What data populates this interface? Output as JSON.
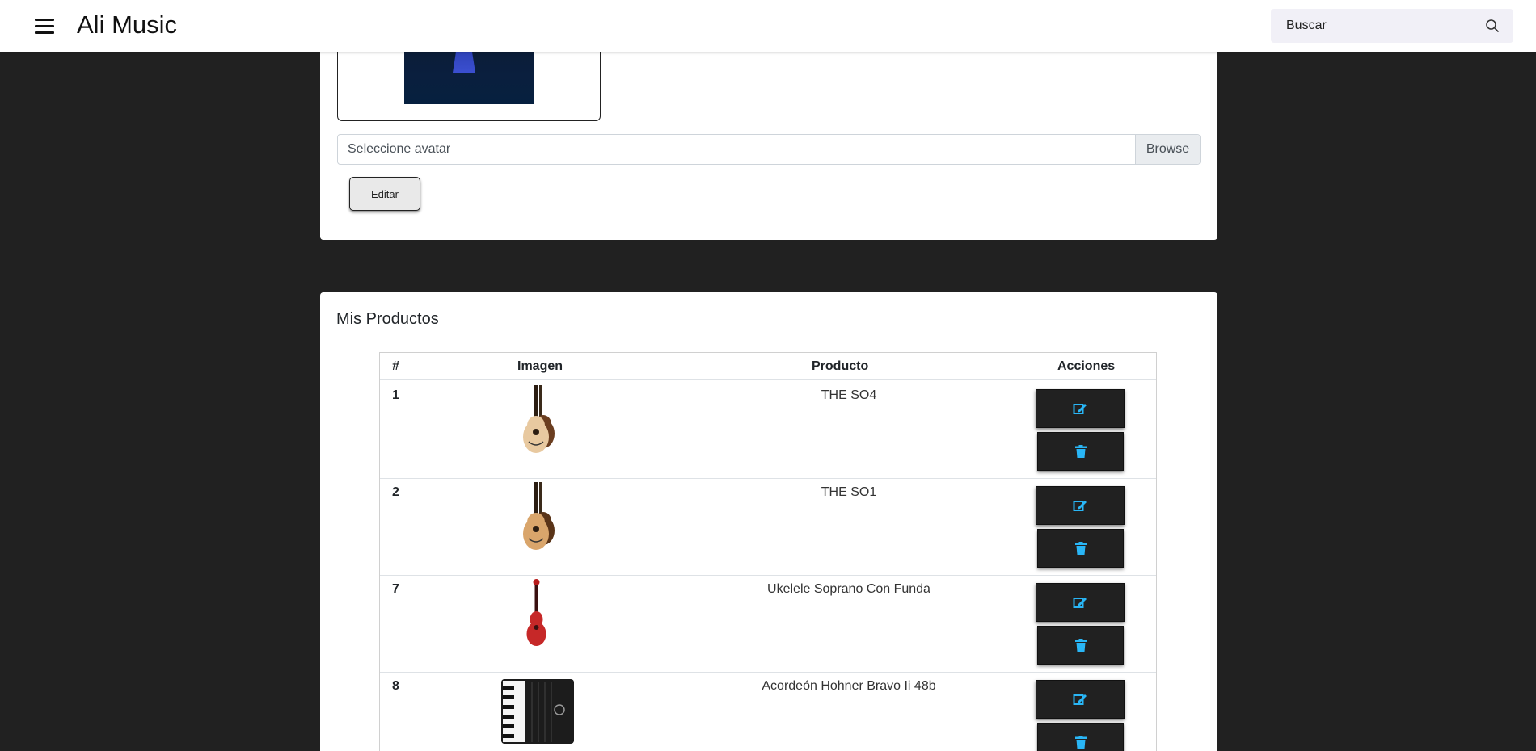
{
  "appbar": {
    "title": "Ali Music",
    "search_placeholder": "Buscar"
  },
  "profile": {
    "avatar_input_label": "Seleccione avatar",
    "browse_label": "Browse",
    "edit_label": "Editar"
  },
  "products": {
    "title": "Mis Productos",
    "columns": [
      "#",
      "Imagen",
      "Producto",
      "Acciones"
    ],
    "rows": [
      {
        "id": "1",
        "name": "THE SO4",
        "image": "acoustic-guitar-image"
      },
      {
        "id": "2",
        "name": "THE SO1",
        "image": "acoustic-guitar-image"
      },
      {
        "id": "7",
        "name": "Ukelele Soprano Con Funda",
        "image": "red-ukulele-image"
      },
      {
        "id": "8",
        "name": "Acordeón Hohner Bravo Ii 48b",
        "image": "accordion-image"
      }
    ]
  },
  "colors": {
    "background": "#212121",
    "action_button": "#212121",
    "action_icon": "#29b6f6"
  },
  "icons": [
    "menu-icon",
    "search-icon",
    "edit-icon",
    "trash-icon"
  ]
}
